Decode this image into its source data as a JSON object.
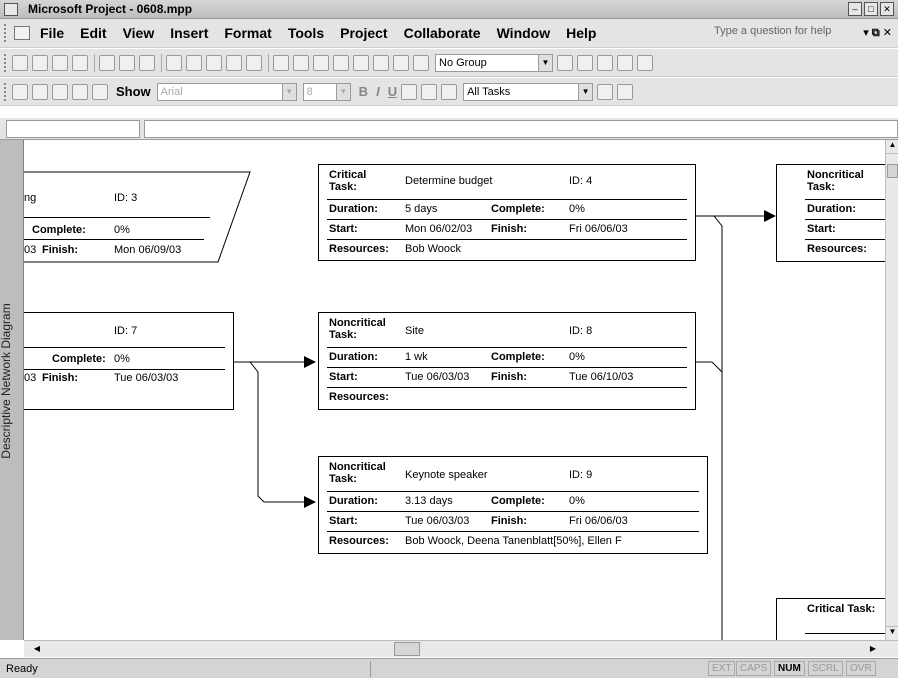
{
  "window": {
    "title": "Microsoft Project - 0608.mpp"
  },
  "menu": {
    "items": [
      "File",
      "Edit",
      "View",
      "Insert",
      "Format",
      "Tools",
      "Project",
      "Collaborate",
      "Window",
      "Help"
    ],
    "help_placeholder": "Type a question for help"
  },
  "toolbar": {
    "group_value": "No Group",
    "font_value": "Arial",
    "size_value": "8",
    "filter_value": "All Tasks",
    "show_label": "Show"
  },
  "viewbar": {
    "label": "Descriptive Network Diagram"
  },
  "labels": {
    "task_critical": "Critical Task:",
    "task_noncritical": "Noncritical Task:",
    "duration": "Duration:",
    "complete": "Complete:",
    "start": "Start:",
    "finish": "Finish:",
    "resources": "Resources:"
  },
  "nodes": {
    "n3": {
      "name": "ng",
      "id": "ID: 3",
      "complete": "0%",
      "start_tail": "03",
      "finish": "Mon 06/09/03"
    },
    "n4": {
      "name": "Determine budget",
      "id": "ID: 4",
      "duration": "5 days",
      "complete": "0%",
      "start": "Mon 06/02/03",
      "finish": "Fri 06/06/03",
      "resources": "Bob Woock"
    },
    "n7": {
      "id": "ID: 7",
      "complete": "0%",
      "start_tail": "03",
      "finish": "Tue 06/03/03"
    },
    "n8": {
      "name": "Site",
      "id": "ID: 8",
      "duration": "1 wk",
      "complete": "0%",
      "start": "Tue 06/03/03",
      "finish": "Tue 06/10/03",
      "resources": ""
    },
    "n9": {
      "name": "Keynote speaker",
      "id": "ID: 9",
      "duration": "3.13 days",
      "complete": "0%",
      "start": "Tue 06/03/03",
      "finish": "Fri 06/06/03",
      "resources": "Bob Woock, Deena Tanenblatt[50%], Ellen F"
    }
  },
  "status": {
    "text": "Ready",
    "indicators": [
      "EXT",
      "CAPS",
      "NUM",
      "SCRL",
      "OVR"
    ],
    "active": "NUM"
  }
}
